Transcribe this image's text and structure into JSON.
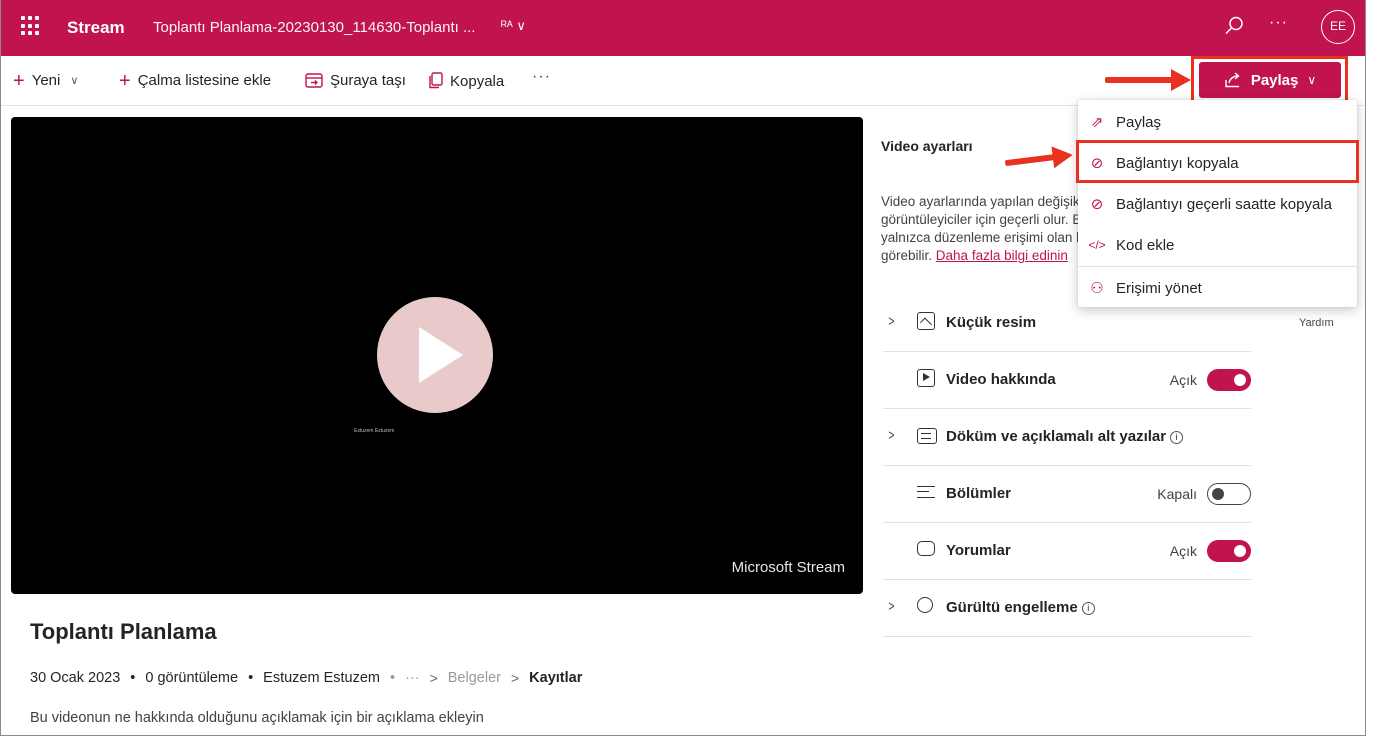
{
  "topbar": {
    "app_name": "Stream",
    "doc_title": "Toplantı Planlama-20230130_114630-Toplantı ...",
    "title_icons": "ᴿᴬ ∨",
    "avatar_initials": "EE",
    "more": "···"
  },
  "commands": {
    "new": "Yeni",
    "add_playlist": "Çalma listesine ekle",
    "move": "Şuraya taşı",
    "copy": "Kopyala",
    "more": "···",
    "share": "Paylaş"
  },
  "share_menu": {
    "items": [
      {
        "label": "Paylaş",
        "icon": "share-icon"
      },
      {
        "label": "Bağlantıyı kopyala",
        "icon": "link-icon"
      },
      {
        "label": "Bağlantıyı geçerli saatte kopyala",
        "icon": "link-time-icon"
      },
      {
        "label": "Kod ekle",
        "icon": "code-icon"
      },
      {
        "label": "Erişimi yönet",
        "icon": "manage-access-icon"
      }
    ]
  },
  "video": {
    "watermark": "Microsoft Stream",
    "presenter": "Estuzem Estuzem"
  },
  "details": {
    "title": "Toplantı Planlama",
    "date": "30 Ocak 2023",
    "views": "0 görüntüleme",
    "owner": "Estuzem Estuzem",
    "dot": "•",
    "crumb_more": "···",
    "crumb_parent": "Belgeler",
    "crumb_current": "Kayıtlar",
    "description_placeholder": "Bu videonun ne hakkında olduğunu açıklamak için bir açıklama ekleyin"
  },
  "settings": {
    "title": "Video ayarları",
    "intro_lines": [
      "Video ayarlarında yapılan değişiklikler tüm",
      "görüntüleyiciler için geçerli olur. Bu ayarları",
      "yalnızca düzenleme erişimi olan kişiler"
    ],
    "intro_last": "görebilir.",
    "learn_more": "Daha fazla bilgi edinin",
    "help": "Yardım",
    "rows": [
      {
        "label": "Küçük resim",
        "state": ""
      },
      {
        "label": "Video hakkında",
        "state": "Açık"
      },
      {
        "label": "Döküm ve açıklamalı alt yazılar",
        "state": ""
      },
      {
        "label": "Bölümler",
        "state": "Kapalı"
      },
      {
        "label": "Yorumlar",
        "state": "Açık"
      },
      {
        "label": "Gürültü engelleme",
        "state": ""
      }
    ],
    "info_glyph": "i"
  },
  "colors": {
    "brand": "#c0134f",
    "annotation": "#e8311f"
  }
}
